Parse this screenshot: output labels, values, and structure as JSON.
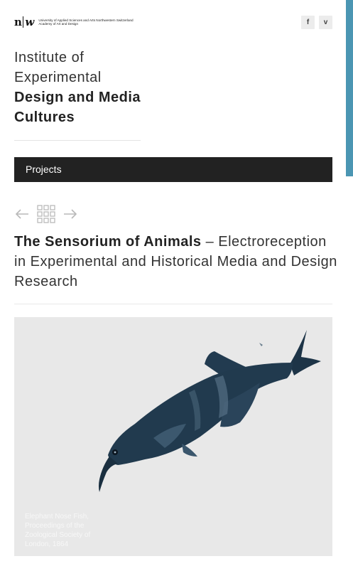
{
  "colors": {
    "accent": "#4b96b3",
    "bar": "#222222",
    "image_bg": "#e8e8e8"
  },
  "header": {
    "logo_mark_left": "n",
    "logo_mark_right": "w",
    "logo_lines": [
      "University of Applied Sciences and Arts Northwestern Switzerland",
      "Academy of Art and Design"
    ],
    "social": [
      {
        "icon": "facebook-icon",
        "label": "f"
      },
      {
        "icon": "vimeo-icon",
        "label": "v"
      }
    ]
  },
  "institute": {
    "line1": "Institute of",
    "line2": "Experimental",
    "line3": "Design and Media",
    "line4": "Cultures"
  },
  "menu": {
    "label": "Projects"
  },
  "nav": {
    "prev_icon": "arrow-left-icon",
    "grid_icon": "grid-icon",
    "next_icon": "arrow-right-icon"
  },
  "project": {
    "title_bold": "The Sensorium of Animals",
    "title_rest": " – Electroreception in Experimental and Historical Media and Design Research"
  },
  "image": {
    "subject": "elephant-nose-fish-illustration",
    "caption_lines": [
      "Elephant Nose Fish,",
      "Proceedings of the",
      "Zoological Society of",
      "London, 1864"
    ]
  }
}
